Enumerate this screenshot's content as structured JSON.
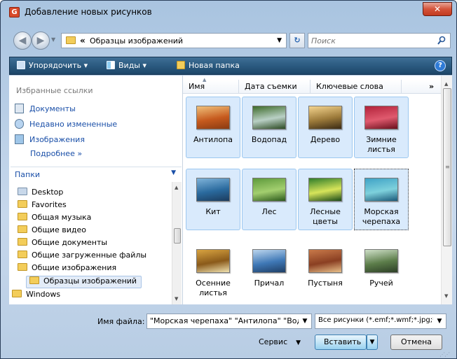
{
  "window": {
    "title": "Добавление новых рисунков",
    "close_label": "✕"
  },
  "address": {
    "separator": "«",
    "path": "Образцы изображений",
    "search_placeholder": "Поиск"
  },
  "toolbar": {
    "organize": "Упорядочить ▾",
    "views": "Виды ▾",
    "new_folder": "Новая папка",
    "help": "?"
  },
  "favorites": {
    "header": "Избранные ссылки",
    "items": [
      {
        "label": "Документы"
      },
      {
        "label": "Недавно измененные"
      },
      {
        "label": "Изображения"
      }
    ],
    "more": "Подробнее »"
  },
  "folders": {
    "header": "Папки",
    "items": [
      {
        "label": "Desktop"
      },
      {
        "label": "Favorites"
      },
      {
        "label": "Общая музыка"
      },
      {
        "label": "Общие видео"
      },
      {
        "label": "Общие документы"
      },
      {
        "label": "Общие загруженные файлы"
      },
      {
        "label": "Общие изображения"
      },
      {
        "label": "Образцы изображений"
      },
      {
        "label": "Windows"
      }
    ]
  },
  "columns": {
    "name": "Имя",
    "date": "Дата съемки",
    "keywords": "Ключевые слова",
    "more": "»"
  },
  "files": [
    {
      "label": "Антилопа",
      "colors": [
        "#f0c07a",
        "#c65a1e",
        "#8a3b12"
      ]
    },
    {
      "label": "Водопад",
      "colors": [
        "#3d6b2a",
        "#b9d0c5",
        "#2c4a22"
      ]
    },
    {
      "label": "Дерево",
      "colors": [
        "#f4d48e",
        "#9c7a3a",
        "#3a2a14"
      ]
    },
    {
      "label": "Зимние листья",
      "colors": [
        "#b2223a",
        "#e05a6e",
        "#6a0f1c"
      ]
    },
    {
      "label": "Кит",
      "colors": [
        "#7fb3d9",
        "#2a6a9e",
        "#1c3c5e"
      ]
    },
    {
      "label": "Лес",
      "colors": [
        "#5e9a3c",
        "#a3cf6f",
        "#2c5a1c"
      ]
    },
    {
      "label": "Лесные цветы",
      "colors": [
        "#2f7d2a",
        "#d7e45a",
        "#1a4a18"
      ]
    },
    {
      "label": "Морская черепаха",
      "colors": [
        "#3fa2c6",
        "#7ed1dc",
        "#1a5a7a"
      ]
    },
    {
      "label": "Осенние листья",
      "colors": [
        "#d9a441",
        "#8a5a1a",
        "#f0e2b0"
      ]
    },
    {
      "label": "Причал",
      "colors": [
        "#bcd6ee",
        "#3f78b6",
        "#1f3f66"
      ]
    },
    {
      "label": "Пустыня",
      "colors": [
        "#c97a4a",
        "#8a3f22",
        "#e8c08a"
      ]
    },
    {
      "label": "Ручей",
      "colors": [
        "#cfe0c8",
        "#5c7d4a",
        "#2d3f26"
      ]
    }
  ],
  "bottom": {
    "filename_label": "Имя файла:",
    "filename_value": "\"Морская черепаха\" \"Антилопа\" \"Водопад\"",
    "filter_value": "Все рисунки (*.emf;*.wmf;*.jpg;*.jpeg;",
    "service": "Сервис",
    "insert": "Вставить",
    "cancel": "Отмена"
  }
}
